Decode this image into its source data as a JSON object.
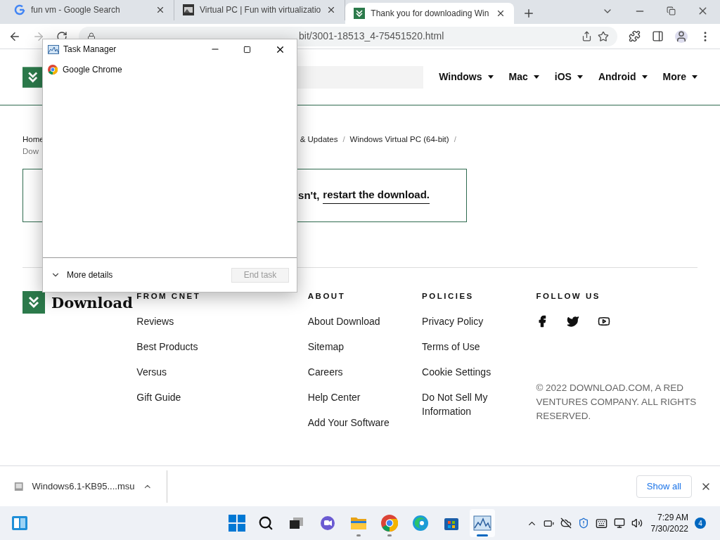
{
  "browser": {
    "tabs": [
      {
        "title": "fun vm - Google Search",
        "kind": "google",
        "selected": false
      },
      {
        "title": "Virtual PC | Fun with virtualizatio",
        "kind": "site",
        "selected": false
      },
      {
        "title": "Thank you for downloading Win",
        "kind": "download",
        "selected": true
      }
    ],
    "url": "bit/3001-18513_4-75451520.html"
  },
  "site": {
    "nav": [
      "Windows",
      "Mac",
      "iOS",
      "Android",
      "More"
    ],
    "breadcrumb_first": "Home",
    "breadcrumb": [
      "& Updates",
      "Windows Virtual PC (64-bit)"
    ],
    "breadcrumb_separator": "/",
    "breadcrumb_second_line": "Dow",
    "message": {
      "text": "sn't,",
      "link": "restart the download."
    },
    "footer": {
      "logo": "Download",
      "columns": [
        {
          "heading": "FROM CNET",
          "links": [
            "Reviews",
            "Best Products",
            "Versus",
            "Gift Guide"
          ]
        },
        {
          "heading": "ABOUT",
          "links": [
            "About Download",
            "Sitemap",
            "Careers",
            "Help Center",
            "Add Your Software"
          ]
        },
        {
          "heading": "POLICIES",
          "links": [
            "Privacy Policy",
            "Terms of Use",
            "Cookie Settings",
            "Do Not Sell My Information"
          ]
        }
      ],
      "follow_heading": "FOLLOW US",
      "copyright": "© 2022 DOWNLOAD.COM, A RED VENTURES COMPANY. ALL RIGHTS RESERVED."
    }
  },
  "download_shelf": {
    "file": "Windows6.1-KB95....msu",
    "show_all": "Show all"
  },
  "task_manager": {
    "title": "Task Manager",
    "apps": [
      "Google Chrome"
    ],
    "more_details": "More details",
    "end_task": {
      "label": "End task",
      "disabled": true
    }
  },
  "taskbar": {
    "apps": [
      {
        "kind": "search",
        "running": false,
        "selected": false
      },
      {
        "kind": "taskview",
        "running": false,
        "selected": false
      },
      {
        "kind": "chat",
        "running": false,
        "selected": false
      },
      {
        "kind": "explorer",
        "running": true,
        "selected": false
      },
      {
        "kind": "chrome",
        "running": true,
        "selected": false
      },
      {
        "kind": "edge",
        "running": false,
        "selected": false
      },
      {
        "kind": "store",
        "running": false,
        "selected": false
      },
      {
        "kind": "taskmanager",
        "running": true,
        "selected": true
      }
    ],
    "time": "7:29 AM",
    "date": "7/30/2022",
    "notifications": "4"
  }
}
